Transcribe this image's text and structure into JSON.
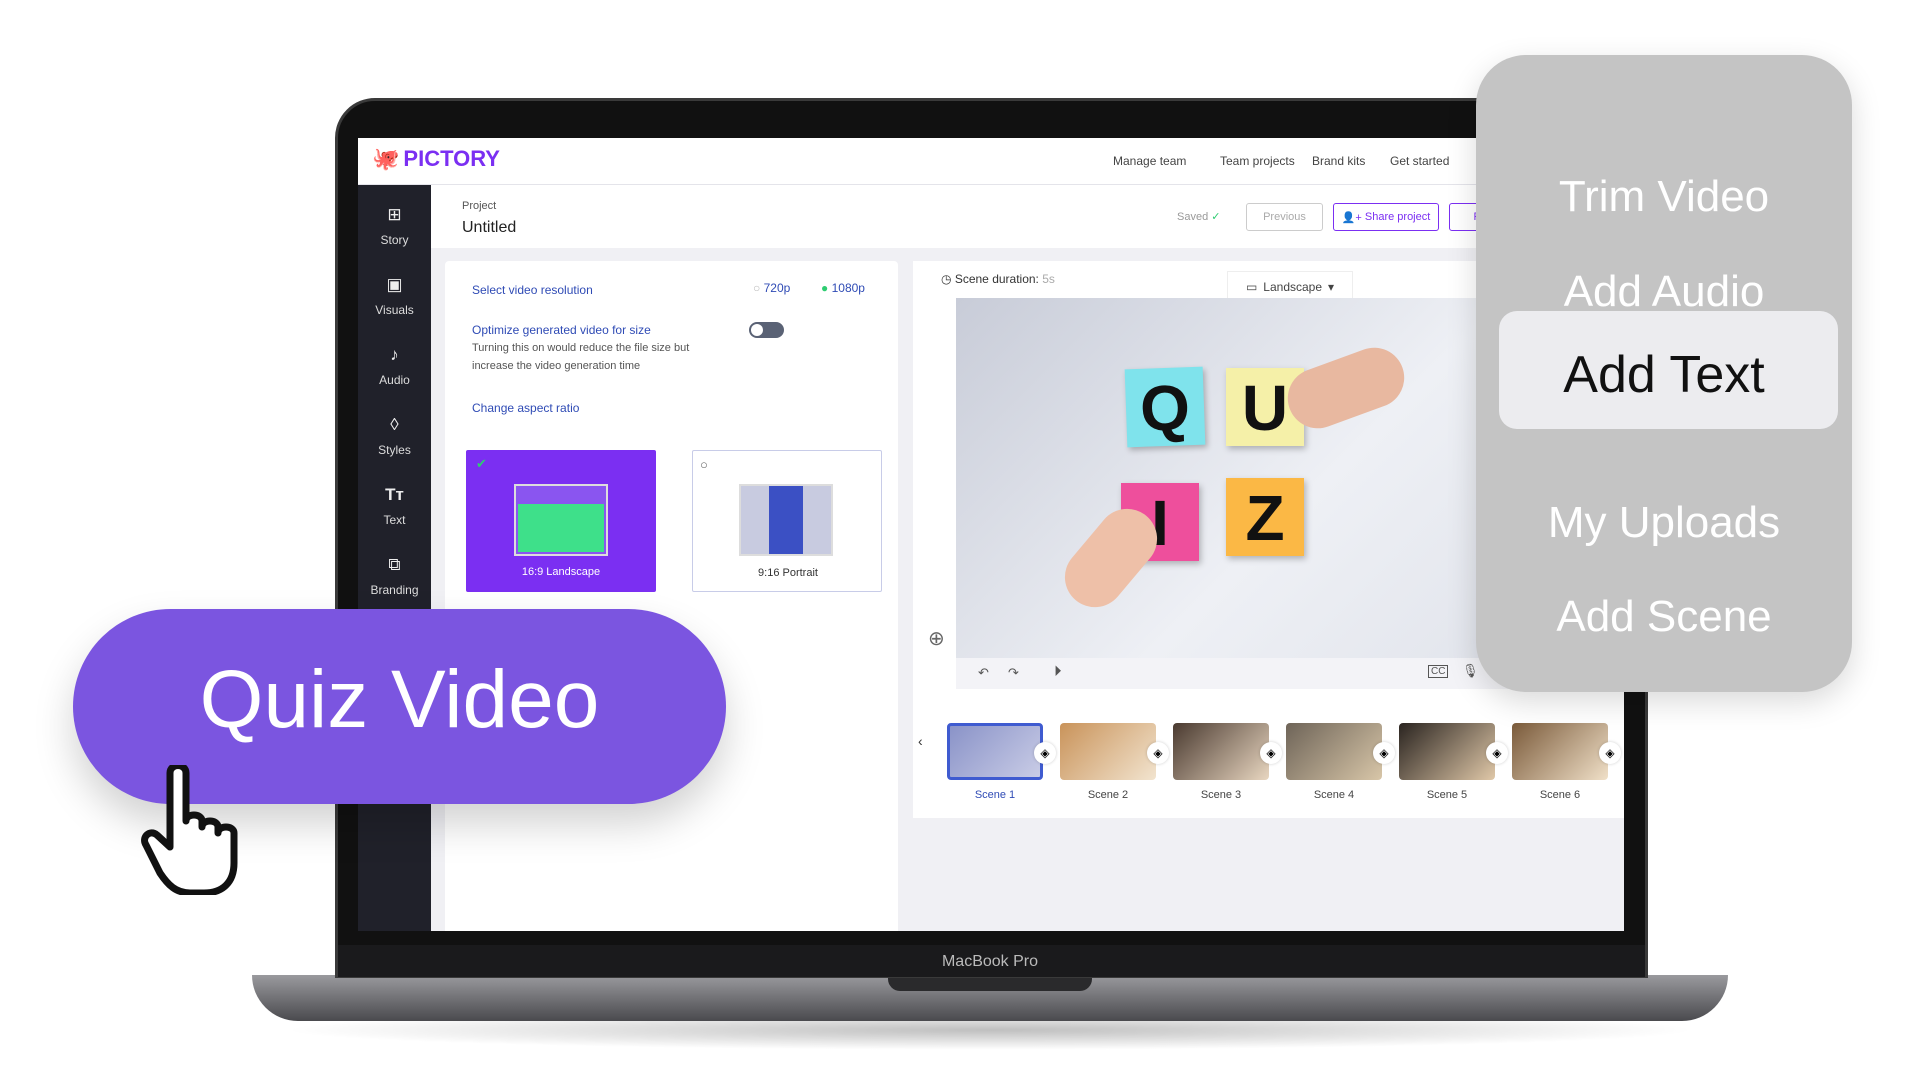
{
  "app": {
    "logo": "PICTORY",
    "nav": [
      "Manage team",
      "Team projects",
      "Brand kits",
      "Get started"
    ]
  },
  "sidebar": {
    "items": [
      {
        "label": "Story",
        "icon": "grid-icon"
      },
      {
        "label": "Visuals",
        "icon": "image-icon"
      },
      {
        "label": "Audio",
        "icon": "music-icon"
      },
      {
        "label": "Styles",
        "icon": "styles-icon"
      },
      {
        "label": "Text",
        "icon": "text-icon"
      },
      {
        "label": "Branding",
        "icon": "briefcase-icon"
      }
    ]
  },
  "project": {
    "label": "Project",
    "title": "Untitled",
    "saved": "Saved",
    "previous": "Previous",
    "share": "Share project",
    "next": "Pr"
  },
  "settings": {
    "resolution_label": "Select video resolution",
    "res_options": [
      "720p",
      "1080p"
    ],
    "selected_res": "1080p",
    "optimize_label": "Optimize generated video for size",
    "optimize_desc": "Turning this on would reduce the file size but increase the video generation time",
    "optimize_on": false,
    "aspect_label": "Change aspect ratio",
    "aspects": [
      "16:9 Landscape",
      "9:16 Portrait"
    ],
    "selected_aspect": "16:9 Landscape"
  },
  "editor": {
    "duration_label": "Scene duration:",
    "duration_value": "5s",
    "orientation": "Landscape",
    "preview_letters": [
      "Q",
      "U",
      "I",
      "Z"
    ]
  },
  "scenes": [
    "Scene 1",
    "Scene 2",
    "Scene 3",
    "Scene 4",
    "Scene 5",
    "Scene 6"
  ],
  "selected_scene": "Scene 1",
  "menu": {
    "items": [
      "Trim Video",
      "Add Audio",
      "Add Text",
      "My Uploads",
      "Add Scene"
    ],
    "highlighted": "Add Text"
  },
  "callout": "Quiz Video",
  "device": "MacBook Pro",
  "colors": {
    "brand": "#7b2ff2",
    "pill": "#7b55e0",
    "link": "#2f4bb5",
    "check": "#2ecc71"
  }
}
